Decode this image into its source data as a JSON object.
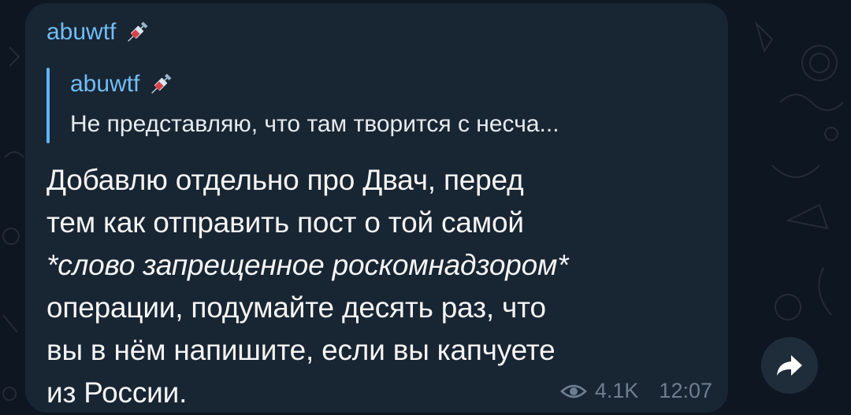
{
  "message": {
    "sender": "abuwtf",
    "sender_badge_icon": "syringe-icon",
    "reply": {
      "author": "abuwtf",
      "text": "Не представляю, что там творится с несча..."
    },
    "lines": [
      "Добавлю отдельно про Двач, перед",
      "тем как отправить пост о той самой",
      "*слово запрещенное роскомнадзором*",
      "операции, подумайте десять раз, что",
      "вы в нём напишите, если вы капчуете",
      "из России."
    ],
    "views": "4.1K",
    "time": "12:07"
  },
  "actions": {
    "forward_icon": "forward-arrow-icon"
  },
  "colors": {
    "background": "#0e1621",
    "bubble": "#182533",
    "accent": "#71bdf4",
    "reply_bar": "#5eb5f7",
    "meta": "#6d7f8f"
  }
}
